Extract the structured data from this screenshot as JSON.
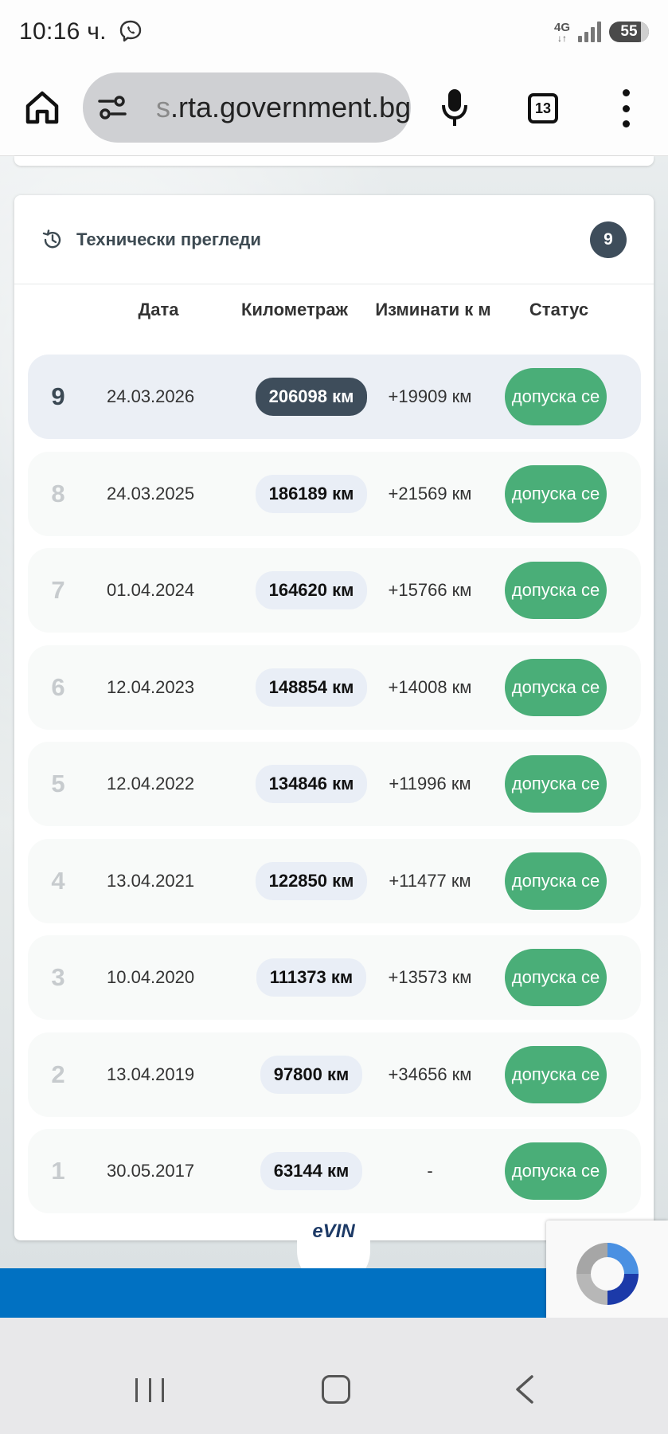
{
  "status_bar": {
    "time": "10:16 ч.",
    "network": "4G",
    "battery": "55"
  },
  "browser": {
    "url_prefix": "s",
    "url_rest": ".rta.government.bg",
    "tab_count": "13"
  },
  "card": {
    "title": "Технически прегледи",
    "count": "9",
    "columns": {
      "date": "Дата",
      "mileage": "Километраж",
      "distance": "Изминати к м",
      "status": "Статус"
    },
    "rows": [
      {
        "num": "9",
        "date": "24.03.2026",
        "km": "206098 км",
        "diff": "+19909 км",
        "status": "допуска се",
        "current": true
      },
      {
        "num": "8",
        "date": "24.03.2025",
        "km": "186189 км",
        "diff": "+21569 км",
        "status": "допуска се",
        "current": false
      },
      {
        "num": "7",
        "date": "01.04.2024",
        "km": "164620 км",
        "diff": "+15766 км",
        "status": "допуска се",
        "current": false
      },
      {
        "num": "6",
        "date": "12.04.2023",
        "km": "148854 км",
        "diff": "+14008 км",
        "status": "допуска се",
        "current": false
      },
      {
        "num": "5",
        "date": "12.04.2022",
        "km": "134846 км",
        "diff": "+11996 км",
        "status": "допуска се",
        "current": false
      },
      {
        "num": "4",
        "date": "13.04.2021",
        "km": "122850 км",
        "diff": "+11477 км",
        "status": "допуска се",
        "current": false
      },
      {
        "num": "3",
        "date": "10.04.2020",
        "km": "111373 км",
        "diff": "+13573 км",
        "status": "допуска се",
        "current": false
      },
      {
        "num": "2",
        "date": "13.04.2019",
        "km": "97800 км",
        "diff": "+34656 км",
        "status": "допуска се",
        "current": false
      },
      {
        "num": "1",
        "date": "30.05.2017",
        "km": "63144 км",
        "diff": "-",
        "status": "допуска се",
        "current": false
      }
    ]
  },
  "footer": {
    "logo_text": "eVIN"
  },
  "colors": {
    "status_green": "#4aae78",
    "dark_slate": "#3e4d5b",
    "brand_blue": "#0171c2"
  }
}
